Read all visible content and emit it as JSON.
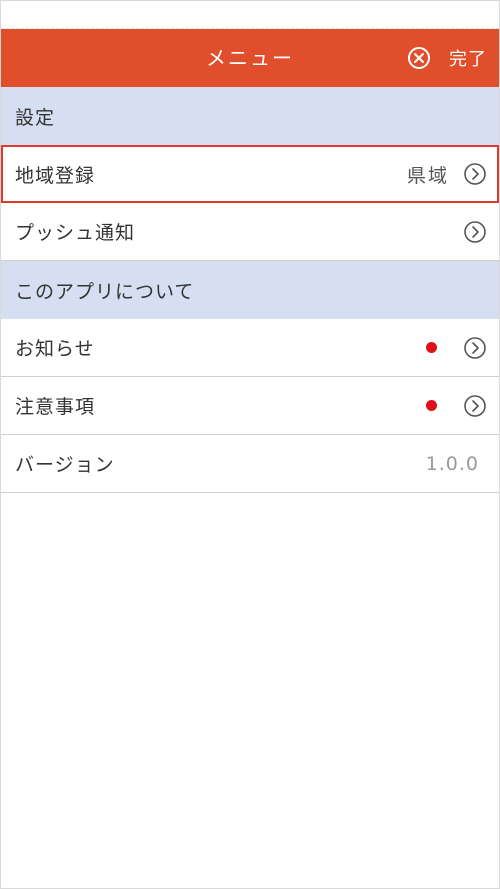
{
  "header": {
    "title": "メニュー",
    "done_label": "完了"
  },
  "settings": {
    "section_label": "設定",
    "region": {
      "label": "地域登録",
      "value": "県域"
    },
    "push": {
      "label": "プッシュ通知"
    }
  },
  "about": {
    "section_label": "このアプリについて",
    "news": {
      "label": "お知らせ"
    },
    "notes": {
      "label": "注意事項"
    },
    "version": {
      "label": "バージョン",
      "value": "1.0.0"
    }
  },
  "colors": {
    "header_bg": "#e04e2c",
    "section_bg": "#d6dff2",
    "highlight_border": "#e03a2c",
    "badge_dot": "#e0101a"
  },
  "icons": {
    "close": "close-circle-icon",
    "chevron": "chevron-right-circle-icon"
  }
}
